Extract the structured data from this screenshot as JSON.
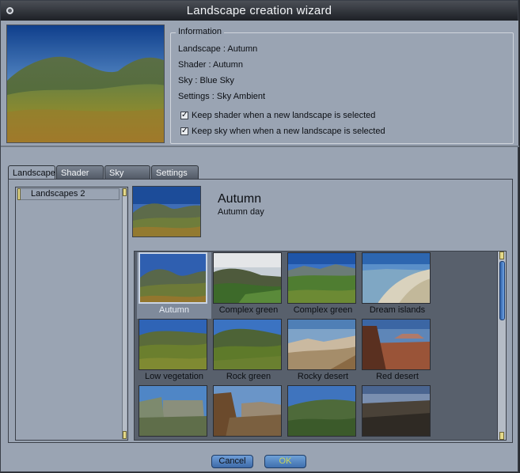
{
  "window": {
    "title": "Landscape creation wizard"
  },
  "information": {
    "legend": "Information",
    "landscape": "Landscape : Autumn",
    "shader": "Shader : Autumn",
    "sky": "Sky : Blue Sky",
    "settings": "Settings : Sky Ambient",
    "keep_shader": {
      "label": "Keep shader when a new landscape is selected",
      "checked": true
    },
    "keep_sky": {
      "label": "Keep sky when when a new landscape is selected",
      "checked": true
    }
  },
  "tabs": [
    {
      "label": "Landscape",
      "active": true
    },
    {
      "label": "Shader",
      "active": false
    },
    {
      "label": "Sky",
      "active": false
    },
    {
      "label": "Settings",
      "active": false
    }
  ],
  "folders": {
    "items": [
      "Landscapes 2"
    ]
  },
  "selected": {
    "name": "Autumn",
    "description": "Autumn day"
  },
  "gallery": {
    "items": [
      {
        "label": "Autumn",
        "selected": true
      },
      {
        "label": "Complex green",
        "selected": false
      },
      {
        "label": "Complex green",
        "selected": false
      },
      {
        "label": "Dream islands",
        "selected": false
      },
      {
        "label": "Low vegetation",
        "selected": false
      },
      {
        "label": "Rock green",
        "selected": false
      },
      {
        "label": "Rocky desert",
        "selected": false
      },
      {
        "label": "Red desert",
        "selected": false
      }
    ]
  },
  "buttons": {
    "cancel": "Cancel",
    "ok": "OK"
  },
  "colors": {
    "panel": "#9aa4b3",
    "titlebar": "#1d2026",
    "button": "#4d7cba",
    "ok_text": "#c9d65a"
  }
}
